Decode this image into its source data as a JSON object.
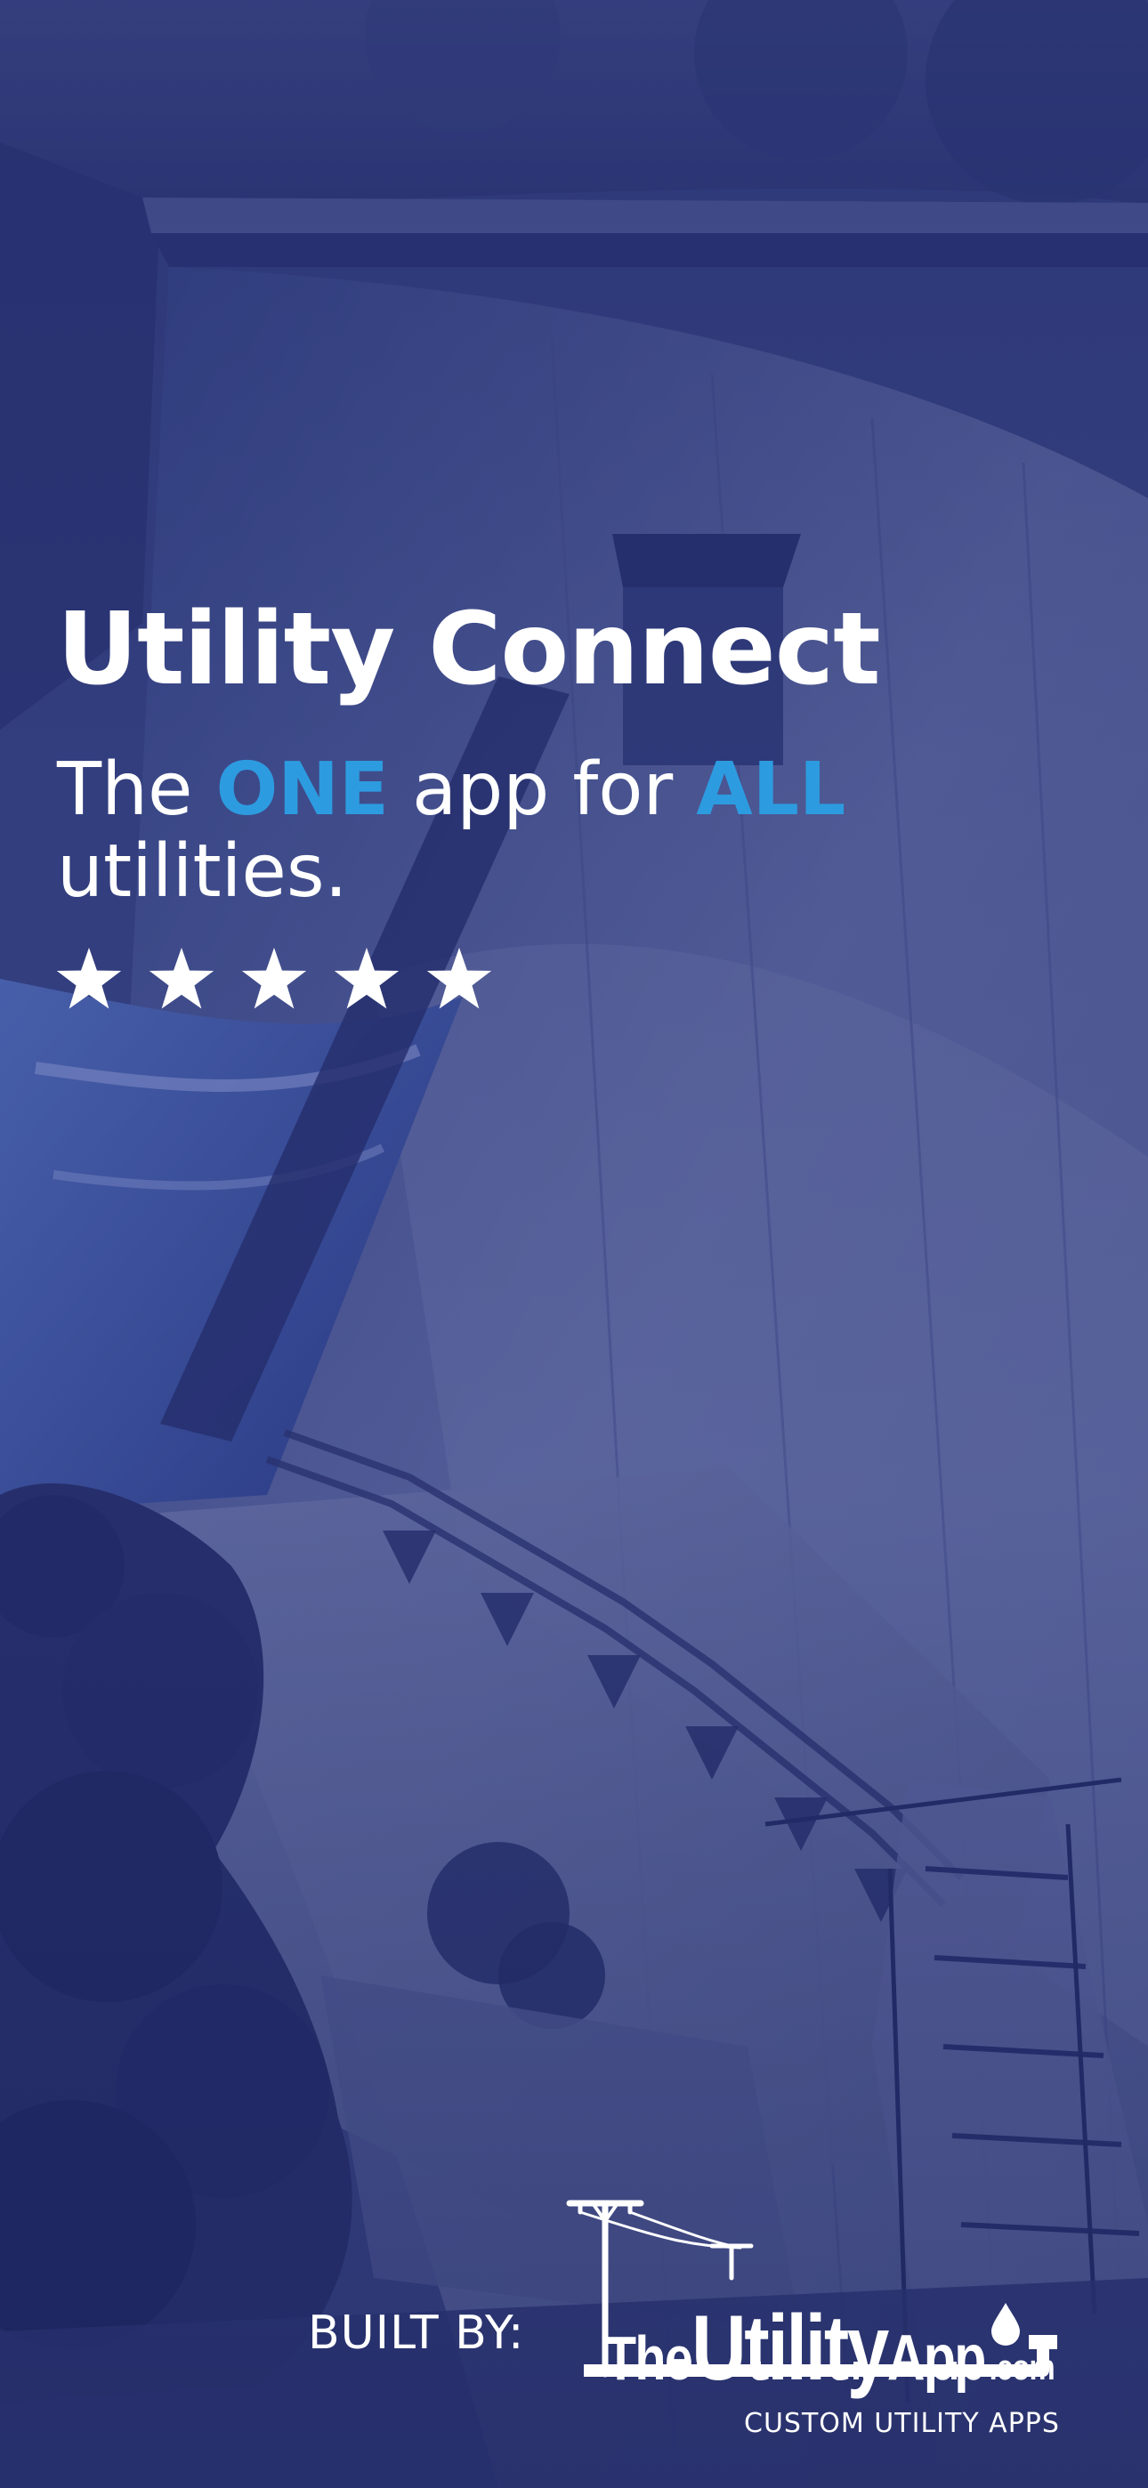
{
  "hero": {
    "title": "Utility Connect",
    "tagline_part1": "The ",
    "tagline_accent1": "ONE",
    "tagline_part2": " app for ",
    "tagline_accent2": "ALL",
    "tagline_part3": "utilities.",
    "rating_stars": 5
  },
  "footer": {
    "built_by_label": "BUILT BY:",
    "brand_the": "The",
    "brand_utility": "Utility",
    "brand_app": "App",
    "brand_com": ".com",
    "brand_tagline": "CUSTOM UTILITY APPS"
  },
  "colors": {
    "overlay": "#2a3672",
    "accent": "#2d9be0",
    "text": "#ffffff"
  },
  "icons": [
    "star-icon",
    "utility-pole-icon",
    "water-drop-icon",
    "pipe-icon"
  ]
}
